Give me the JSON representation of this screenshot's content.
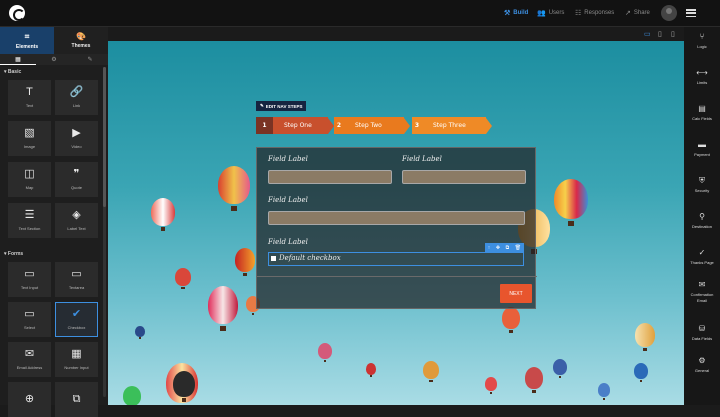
{
  "topnav": {
    "items": [
      {
        "label": "Build",
        "icon": "build-icon",
        "active": true
      },
      {
        "label": "Users",
        "icon": "users-icon",
        "active": false
      },
      {
        "label": "Responses",
        "icon": "responses-icon",
        "active": false
      },
      {
        "label": "Share",
        "icon": "share-icon",
        "active": false
      }
    ]
  },
  "left_panel": {
    "tabs": [
      {
        "label": "Elements",
        "icon": "elements-icon"
      },
      {
        "label": "Themes",
        "icon": "palette-icon"
      }
    ],
    "sections": [
      {
        "title": "Basic",
        "items": [
          {
            "label": "Text",
            "glyph": "T"
          },
          {
            "label": "Link",
            "glyph": "🔗"
          },
          {
            "label": "Image",
            "glyph": "▧"
          },
          {
            "label": "Video",
            "glyph": "▶"
          },
          {
            "label": "Map",
            "glyph": "◫"
          },
          {
            "label": "Quote",
            "glyph": "❞"
          },
          {
            "label": "Text Section",
            "glyph": "☰"
          },
          {
            "label": "Label Text",
            "glyph": "◈"
          }
        ]
      },
      {
        "title": "Forms",
        "items": [
          {
            "label": "Text Input",
            "glyph": "▭"
          },
          {
            "label": "Textarea",
            "glyph": "▭"
          },
          {
            "label": "Select",
            "glyph": "▭"
          },
          {
            "label": "Checkbox",
            "glyph": "✔"
          },
          {
            "label": "Email Address",
            "glyph": "✉"
          },
          {
            "label": "Number Input",
            "glyph": "▦"
          },
          {
            "label": "",
            "glyph": "⊕"
          },
          {
            "label": "",
            "glyph": "⧉"
          }
        ]
      }
    ]
  },
  "nav_steps": {
    "edit_label": "EDIT NAV STEPS",
    "steps": [
      {
        "num": "1",
        "label": "Step One"
      },
      {
        "num": "2",
        "label": "Step Two"
      },
      {
        "num": "3",
        "label": "Step Three"
      }
    ]
  },
  "form": {
    "field_label": "Field Label",
    "checkbox_label": "Default checkbox",
    "next_label": "NEXT"
  },
  "right_sidebar": [
    {
      "label": "Logic",
      "glyph": "⑂"
    },
    {
      "label": "Limits",
      "glyph": "⟷"
    },
    {
      "label": "Calc Fields",
      "glyph": "▤"
    },
    {
      "label": "Payment",
      "glyph": "▬"
    },
    {
      "label": "Security",
      "glyph": "⛨"
    },
    {
      "label": "Destination",
      "glyph": "⚲"
    },
    {
      "label": "Thanks Page",
      "glyph": "✓"
    },
    {
      "label": "Confirmation Email",
      "glyph": "✉"
    },
    {
      "label": "Data Fields",
      "glyph": "⛁"
    },
    {
      "label": "General",
      "glyph": "⚙"
    }
  ],
  "colors": {
    "accent": "#3d8fe0",
    "step_one": "#c8502d",
    "step_two": "#e97a1e",
    "step_three": "#ef8a26",
    "next": "#e8552d"
  }
}
